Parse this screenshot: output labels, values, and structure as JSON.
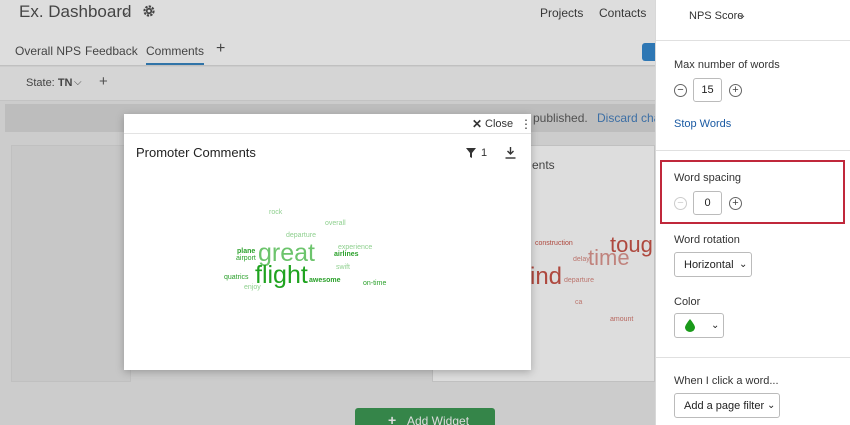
{
  "header": {
    "title": "Ex. Dashboard",
    "nav": [
      "Projects",
      "Contacts"
    ]
  },
  "tabs": [
    {
      "label": "Overall NPS",
      "active": false
    },
    {
      "label": "Feedback",
      "active": false
    },
    {
      "label": "Comments",
      "active": true
    }
  ],
  "filter_bar": {
    "state_label": "State:",
    "state_value": "TN"
  },
  "notice": {
    "text": "published.",
    "link": "Discard chan"
  },
  "widget_right": {
    "title_fragment": "ents"
  },
  "add_widget_label": "Add Widget",
  "modal": {
    "close_label": "Close",
    "title": "Promoter Comments",
    "filter_count": "1",
    "word_cloud": [
      {
        "text": "great",
        "size": 25,
        "color": "#6cc46c"
      },
      {
        "text": "flight",
        "size": 25,
        "color": "#1fa31f"
      },
      {
        "text": "rock",
        "size": 7,
        "color": "#8fd08f"
      },
      {
        "text": "overall",
        "size": 7,
        "color": "#8fd08f"
      },
      {
        "text": "departure",
        "size": 7,
        "color": "#8fd08f"
      },
      {
        "text": "experience",
        "size": 7,
        "color": "#8fd08f"
      },
      {
        "text": "plane",
        "size": 7,
        "color": "#2aa02a"
      },
      {
        "text": "airport",
        "size": 7,
        "color": "#2aa02a"
      },
      {
        "text": "airlines",
        "size": 7,
        "color": "#2aa02a"
      },
      {
        "text": "swift",
        "size": 7,
        "color": "#8fd08f"
      },
      {
        "text": "quatrics",
        "size": 7,
        "color": "#2aa02a"
      },
      {
        "text": "awesome",
        "size": 7,
        "color": "#2aa02a"
      },
      {
        "text": "enjoy",
        "size": 7,
        "color": "#8fd08f"
      },
      {
        "text": "on-time",
        "size": 7,
        "color": "#2aa02a"
      }
    ]
  },
  "right_cloud": [
    "toug",
    "time",
    "ind",
    "construction",
    "delay",
    "departure",
    "ca",
    "amount"
  ],
  "panel": {
    "metric": "NPS Score",
    "max_words_label": "Max number of words",
    "max_words_value": "15",
    "stop_words_link": "Stop Words",
    "word_spacing_label": "Word spacing",
    "word_spacing_value": "0",
    "word_rotation_label": "Word rotation",
    "word_rotation_value": "Horizontal",
    "color_label": "Color",
    "color_value": "#1a9a1a",
    "on_click_label": "When I click a word...",
    "on_click_value": "Add a page filter"
  }
}
